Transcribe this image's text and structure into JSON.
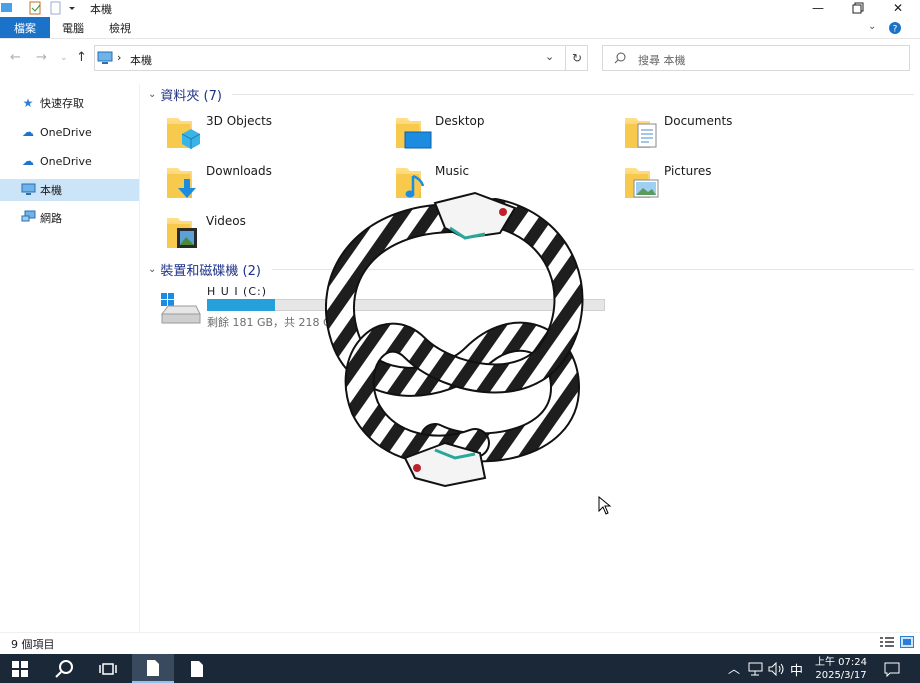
{
  "window": {
    "title": "本機"
  },
  "ribbon": {
    "tabs": [
      "檔案",
      "電腦",
      "檢視"
    ]
  },
  "address": {
    "path": "本機",
    "separator": "›"
  },
  "search": {
    "placeholder": "搜尋 本機"
  },
  "sidebar": {
    "items": [
      {
        "label": "快速存取",
        "icon": "star-icon"
      },
      {
        "label": "OneDrive",
        "icon": "cloud-icon"
      },
      {
        "label": "OneDrive",
        "icon": "cloud-icon"
      },
      {
        "label": "本機",
        "icon": "computer-icon",
        "selected": true
      },
      {
        "label": "網路",
        "icon": "network-icon"
      }
    ]
  },
  "folders_group": {
    "title": "資料夾 (7)"
  },
  "folders": [
    {
      "name": "3D Objects",
      "icon": "3d-objects-folder-icon"
    },
    {
      "name": "Desktop",
      "icon": "desktop-folder-icon"
    },
    {
      "name": "Documents",
      "icon": "documents-folder-icon"
    },
    {
      "name": "Downloads",
      "icon": "downloads-folder-icon"
    },
    {
      "name": "Music",
      "icon": "music-folder-icon"
    },
    {
      "name": "Pictures",
      "icon": "pictures-folder-icon"
    },
    {
      "name": "Videos",
      "icon": "videos-folder-icon"
    }
  ],
  "devices_group": {
    "title": "裝置和磁碟機 (2)"
  },
  "drive": {
    "name": "H U I  (C:)",
    "space": "剩餘 181 GB，共 218 GB",
    "used_fraction": 0.17
  },
  "status": {
    "items_count": "9 個項目"
  },
  "taskbar": {
    "time": "上午 07:24",
    "date": "2025/3/17",
    "ime": "中"
  },
  "colors": {
    "accent": "#1a73c8",
    "selection": "#cce4f7",
    "group_heading": "#1e3287",
    "taskbar": "#1b2838",
    "drive_fill": "#26a0da"
  }
}
